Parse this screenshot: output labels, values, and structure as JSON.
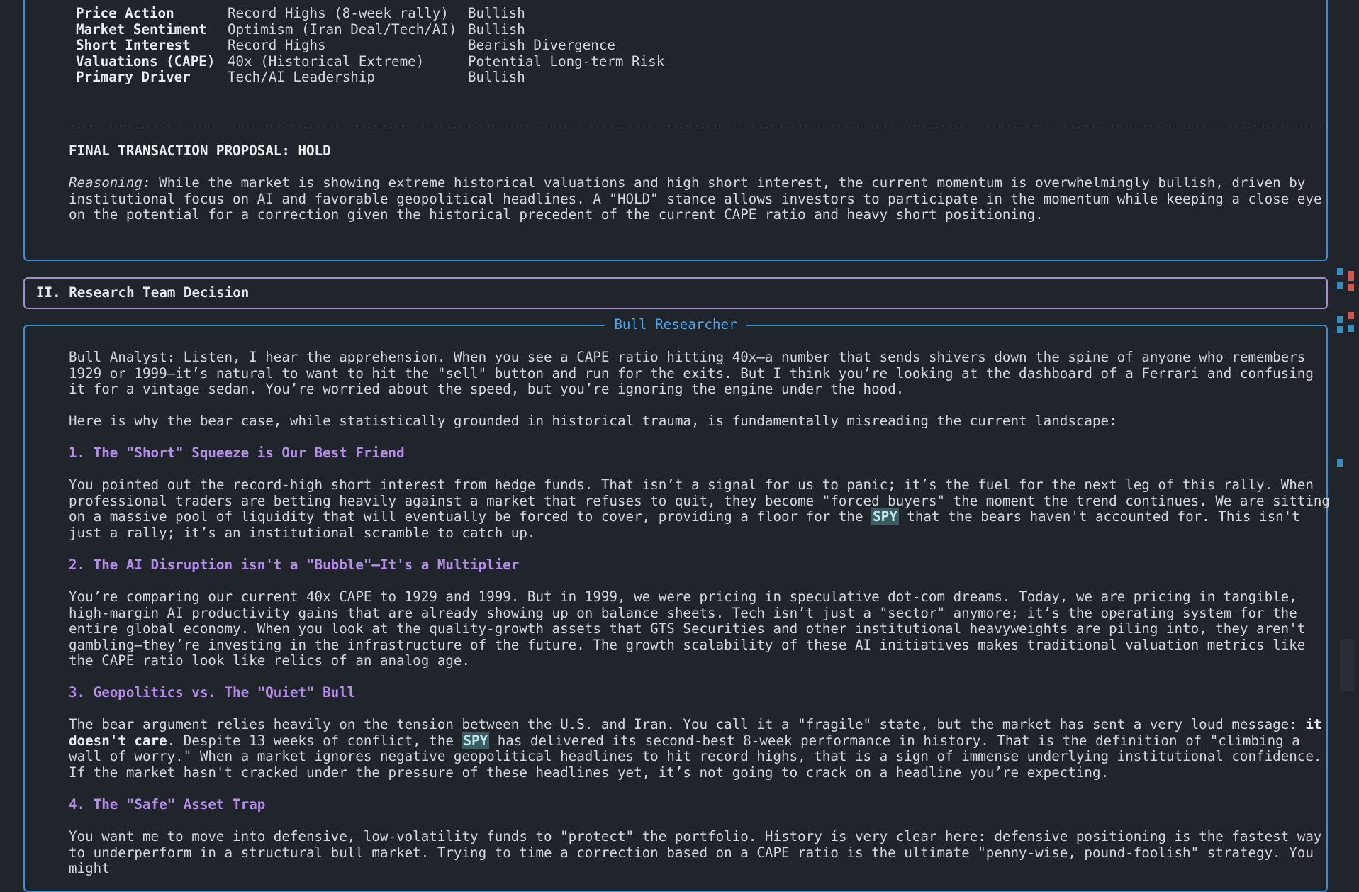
{
  "summary_table": {
    "rows": [
      {
        "factor": "Price Action",
        "status": "Record Highs (8-week rally)",
        "signal": "Bullish"
      },
      {
        "factor": "Market Sentiment",
        "status": "Optimism (Iran Deal/Tech/AI)",
        "signal": "Bullish"
      },
      {
        "factor": "Short Interest",
        "status": "Record Highs",
        "signal": "Bearish Divergence"
      },
      {
        "factor": "Valuations (CAPE)",
        "status": "40x (Historical Extreme)",
        "signal": "Potential Long-term Risk"
      },
      {
        "factor": "Primary Driver",
        "status": "Tech/AI Leadership",
        "signal": "Bullish"
      }
    ]
  },
  "proposal": {
    "title": "FINAL TRANSACTION PROPOSAL: HOLD",
    "reasoning_label": "Reasoning:",
    "reasoning_text": " While the market is showing extreme historical valuations and high short interest, the current momentum is overwhelmingly bullish, driven by institutional focus on AI and favorable geopolitical headlines. A \"HOLD\" stance allows investors to participate in the momentum while keeping a close eye on the potential for a correction given the historical precedent of the current CAPE ratio and heavy short positioning."
  },
  "section": {
    "title": "II. Research Team Decision"
  },
  "bull": {
    "panel_title": "Bull Researcher",
    "intro": "Bull Analyst: Listen, I hear the apprehension. When you see a CAPE ratio hitting 40x—a number that sends shivers down the spine of anyone who remembers 1929 or 1999—it’s natural to want to hit the \"sell\" button and run for the exits. But I think you’re looking at the dashboard of a Ferrari and confusing it for a vintage sedan. You’re worried about the speed, but you’re ignoring the engine under the hood.",
    "lead": "Here is why the bear case, while statistically grounded in historical trauma, is fundamentally misreading the current landscape:",
    "h1": "1. The \"Short\" Squeeze is Our Best Friend",
    "p1a": "You pointed out the record-high short interest from hedge funds. That isn’t a signal for us to panic; it’s the fuel for the next leg of this rally. When professional traders are betting heavily against a market that refuses to quit, they become \"forced buyers\" the moment the trend continues. We are sitting on a massive pool of liquidity that will eventually be forced to cover, providing a floor for the ",
    "ticker": "SPY",
    "p1b": " that the bears haven't accounted for. This isn't just a rally; it’s an institutional scramble to catch up.",
    "h2": "2. The AI Disruption isn't a \"Bubble\"—It's a Multiplier",
    "p2": "You’re comparing our current 40x CAPE to 1929 and 1999. But in 1999, we were pricing in speculative dot-com dreams. Today, we are pricing in tangible, high-margin AI productivity gains that are already showing up on balance sheets. Tech isn’t just a \"sector\" anymore; it’s the operating system for the entire global economy. When you look at the quality-growth assets that GTS Securities and other institutional heavyweights are piling into, they aren't gambling—they’re investing in the infrastructure of the future. The growth scalability of these AI initiatives makes traditional valuation metrics like the CAPE ratio look like relics of an analog age.",
    "h3": "3. Geopolitics vs. The \"Quiet\" Bull",
    "p3a": "The bear argument relies heavily on the tension between the U.S. and Iran. You call it a \"fragile\" state, but the market has sent a very loud message: ",
    "p3_bold": "it doesn't care",
    "p3b": ". Despite 13 weeks of conflict, the ",
    "p3c": " has delivered its second-best 8-week performance in history. That is the definition of \"climbing a wall of worry.\" When a market ignores negative geopolitical headlines to hit record highs, that is a sign of immense underlying institutional confidence. If the market hasn't cracked under the pressure of these headlines yet, it’s not going to crack on a headline you’re expecting.",
    "h4": "4. The \"Safe\" Asset Trap",
    "p4": "You want me to move into defensive, low-volatility funds to \"protect\" the portfolio. History is very clear here: defensive positioning is the fastest way to underperform in a structural bull market. Trying to time a correction based on a CAPE ratio is the ultimate \"penny-wise, pound-foolish\" strategy. You might"
  },
  "colors": {
    "background": "#20242b",
    "panel_border": "#3b8fd6",
    "section_border": "#a78bd0",
    "heading": "#b48ee8",
    "title": "#4aa6f0"
  }
}
